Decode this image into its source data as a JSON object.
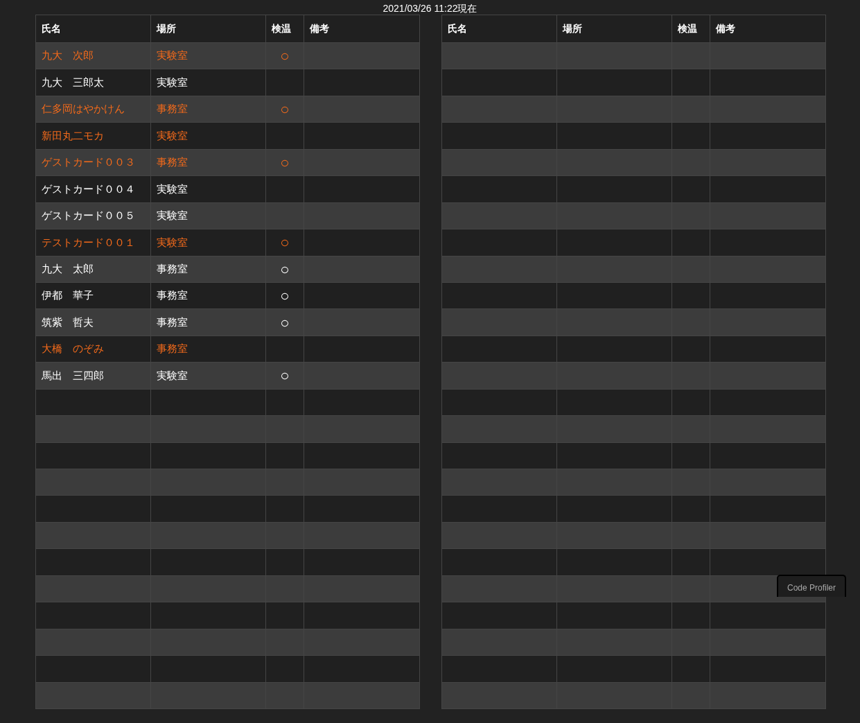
{
  "timestamp": "2021/03/26 11:22現在",
  "tables": [
    {
      "columns": [
        "氏名",
        "場所",
        "検温",
        "備考"
      ],
      "rows": [
        {
          "name": "九大　次郎",
          "place": "実験室",
          "temp_check": "○",
          "alert": true
        },
        {
          "name": "九大　三郎太",
          "place": "実験室",
          "alert": false
        },
        {
          "name": "仁多岡はやかけん",
          "place": "事務室",
          "temp_check": "○",
          "alert": true
        },
        {
          "name": "新田丸二モカ",
          "place": "実験室",
          "alert": true
        },
        {
          "name": "ゲストカード００３",
          "place": "事務室",
          "temp_check": "○",
          "alert": true
        },
        {
          "name": "ゲストカード００４",
          "place": "実験室",
          "alert": false
        },
        {
          "name": "ゲストカード００５",
          "place": "実験室",
          "alert": false
        },
        {
          "name": "テストカード００１",
          "place": "実験室",
          "temp_check": "○",
          "alert": true
        },
        {
          "name": "九大　太郎",
          "place": "事務室",
          "temp_check": "○",
          "alert": false
        },
        {
          "name": "伊都　華子",
          "place": "事務室",
          "temp_check": "○",
          "alert": false
        },
        {
          "name": "筑紫　哲夫",
          "place": "事務室",
          "temp_check": "○",
          "alert": false
        },
        {
          "name": "大橋　のぞみ",
          "place": "事務室",
          "alert": true
        },
        {
          "name": "馬出　三四郎",
          "place": "実験室",
          "temp_check": "○",
          "alert": false
        }
      ]
    },
    {
      "columns": [
        "氏名",
        "場所",
        "検温",
        "備考"
      ]
    }
  ],
  "profiler_tab": {
    "label": "Code Profiler"
  }
}
